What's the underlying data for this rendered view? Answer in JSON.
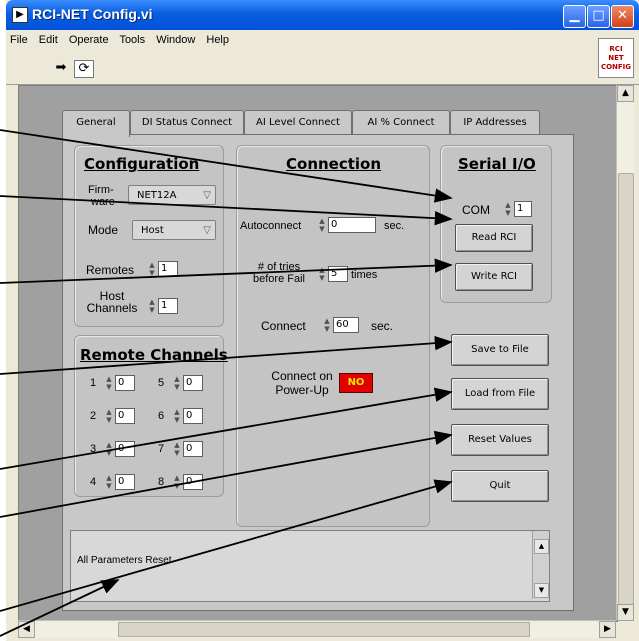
{
  "window": {
    "title": "RCI-NET Config.vi",
    "app_icon": "labview-vi-icon",
    "controls": [
      "minimize-icon",
      "maximize-icon",
      "close-icon"
    ]
  },
  "menu": [
    "File",
    "Edit",
    "Operate",
    "Tools",
    "Window",
    "Help"
  ],
  "toolbar": {
    "tools": [
      "run-arrow-icon",
      "run-continuously-icon"
    ],
    "logo_lines": [
      "RCI",
      "NET",
      "CONFIG"
    ]
  },
  "tabs": [
    "General",
    "DI Status Connect",
    "AI Level Connect",
    "AI % Connect",
    "IP Addresses"
  ],
  "configuration": {
    "title": "Configuration",
    "firmware_label_1": "Firm-",
    "firmware_label_2": "ware",
    "firmware_value": "NET12A",
    "mode_label": "Mode",
    "mode_value": "Host",
    "remotes_label": "Remotes",
    "remotes_value": "1",
    "host_label_1": "Host",
    "host_label_2": "Channels",
    "host_value": "1"
  },
  "remote_channels": {
    "title": "Remote Channels",
    "channels": [
      {
        "num": "1",
        "value": "0"
      },
      {
        "num": "2",
        "value": "0"
      },
      {
        "num": "3",
        "value": "0"
      },
      {
        "num": "4",
        "value": "0"
      },
      {
        "num": "5",
        "value": "0"
      },
      {
        "num": "6",
        "value": "0"
      },
      {
        "num": "7",
        "value": "0"
      },
      {
        "num": "8",
        "value": "0"
      }
    ]
  },
  "connection": {
    "title": "Connection",
    "autoconnect_label": "Autoconnect",
    "autoconnect_value": "0",
    "autoconnect_unit": "sec.",
    "tries_label_1": "# of tries",
    "tries_label_2": "before Fail",
    "tries_value": "5",
    "tries_unit": "times",
    "connect_label": "Connect",
    "connect_value": "60",
    "connect_unit": "sec.",
    "power_label_1": "Connect on",
    "power_label_2": "Power-Up",
    "power_value": "NO"
  },
  "serial": {
    "title": "Serial I/O",
    "com_label": "COM",
    "com_value": "1",
    "read_label": "Read RCI",
    "write_label": "Write RCI"
  },
  "buttons": {
    "save": "Save to File",
    "load": "Load from File",
    "reset": "Reset Values",
    "quit": "Quit"
  },
  "status": {
    "text": "All Parameters Reset"
  },
  "colors": {
    "titlebar": "#0a5fe0",
    "led_off": "#e00000",
    "led_text": "#ffe000",
    "panel": "#a0a0a0"
  }
}
